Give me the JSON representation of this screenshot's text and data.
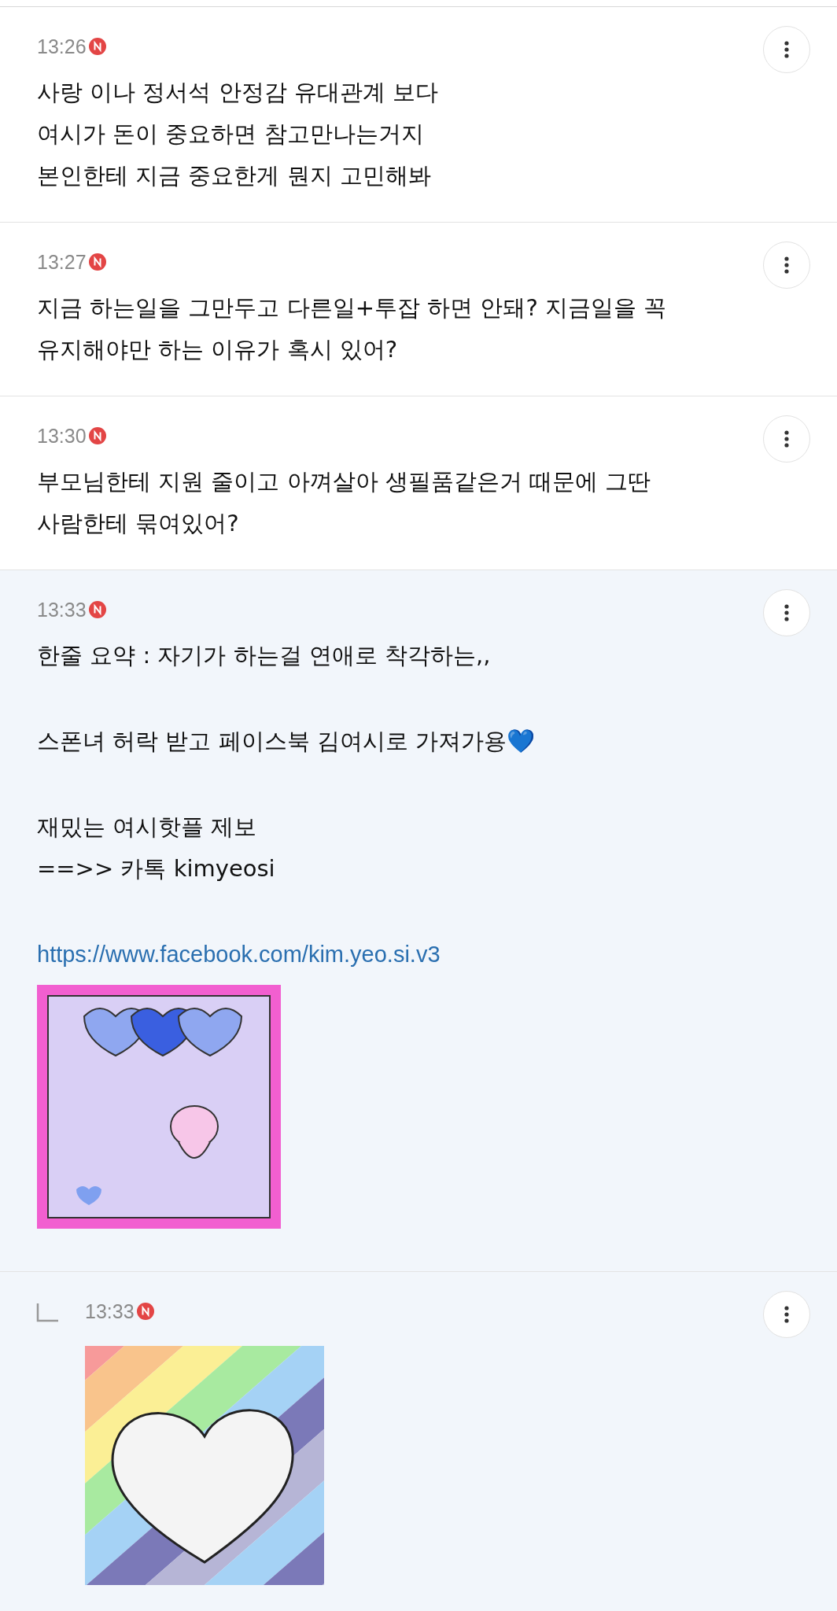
{
  "comments": [
    {
      "kind": "comment",
      "time": "13:26",
      "is_new": true,
      "highlighted": false,
      "paragraphs": [
        "사랑 이나 정서석 안정감 유대관계 보다\n여시가 돈이 중요하면 참고만나는거지\n본인한테 지금 중요한게 뭔지 고민해봐"
      ]
    },
    {
      "kind": "comment",
      "time": "13:27",
      "is_new": true,
      "highlighted": false,
      "paragraphs": [
        "지금 하는일을 그만두고 다른일+투잡 하면 안돼? 지금일을 꼭\n유지해야만 하는 이유가 혹시 있어?"
      ]
    },
    {
      "kind": "comment",
      "time": "13:30",
      "is_new": true,
      "highlighted": false,
      "paragraphs": [
        "부모님한테 지원 줄이고 아껴살아 생필품같은거 때문에 그딴\n사람한테 묶여있어?"
      ]
    },
    {
      "kind": "comment",
      "time": "13:33",
      "is_new": true,
      "highlighted": true,
      "paragraphs": [
        "한줄 요약 : 자기가 하는걸 연애로 착각하는,,",
        "스폰녀 허락 받고 페이스북 김여시로 가져가용💙",
        "재밌는 여시핫플 제보\n==>> 카톡 kimyeosi"
      ],
      "link": "https://www.facebook.com/kim.yeo.si.v3",
      "image": {
        "kind": "request"
      }
    },
    {
      "kind": "reply",
      "time": "13:33",
      "is_new": true,
      "highlighted": true,
      "image": {
        "kind": "rainbow"
      }
    }
  ]
}
